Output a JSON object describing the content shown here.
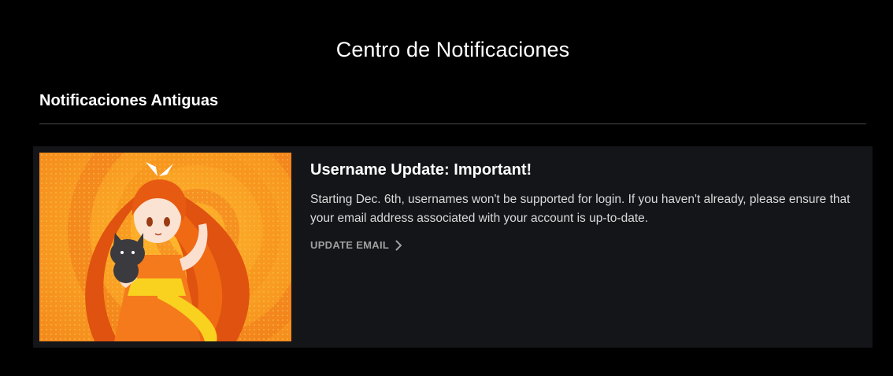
{
  "page": {
    "title": "Centro de Notificaciones"
  },
  "section": {
    "title": "Notificaciones Antiguas"
  },
  "notifications": [
    {
      "title": "Username Update: Important!",
      "body": "Starting Dec. 6th, usernames won't be supported for login. If you haven't already, please ensure that your email address associated with your account is up-to-date.",
      "action_label": "UPDATE EMAIL",
      "action_icon": "chevron-right-icon",
      "thumbnail": "crunchyroll-hime-mascot-illustration"
    }
  ],
  "colors": {
    "background": "#000000",
    "card_background": "#141519",
    "divider": "#4a4a4f",
    "accent_orange": "#f47521",
    "muted_text": "#a0a0a0"
  }
}
